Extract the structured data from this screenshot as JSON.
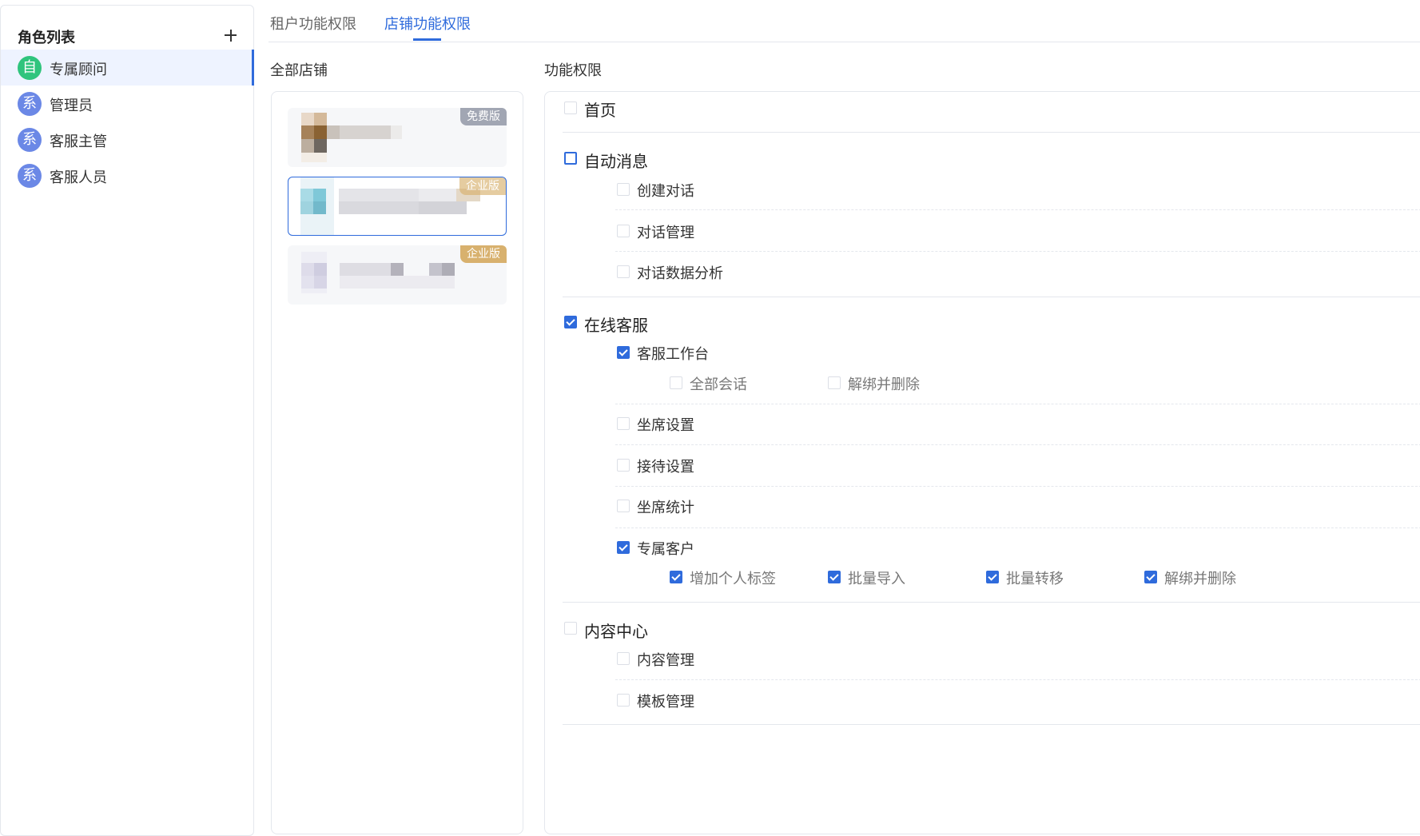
{
  "sidebar": {
    "title": "角色列表",
    "roles": [
      {
        "label": "专属顾问",
        "avatar": "自",
        "avatar_color": "#2fc47d",
        "active": true
      },
      {
        "label": "管理员",
        "avatar": "系",
        "avatar_color": "#6b88e6",
        "active": false
      },
      {
        "label": "客服主管",
        "avatar": "系",
        "avatar_color": "#6b88e6",
        "active": false
      },
      {
        "label": "客服人员",
        "avatar": "系",
        "avatar_color": "#6b88e6",
        "active": false
      }
    ]
  },
  "tabs": [
    {
      "label": "租户功能权限",
      "active": false
    },
    {
      "label": "店铺功能权限",
      "active": true
    }
  ],
  "stores": {
    "title": "全部店铺",
    "cards": [
      {
        "badge": "免费版",
        "badge_type": "free",
        "selected": false
      },
      {
        "badge": "企业版",
        "badge_type": "pro",
        "selected": true
      },
      {
        "badge": "企业版",
        "badge_type": "pro",
        "selected": false
      }
    ]
  },
  "permissions": {
    "title": "功能权限",
    "groups": [
      {
        "label": "首页",
        "checked": false,
        "children": []
      },
      {
        "label": "自动消息",
        "checked": false,
        "children": [
          {
            "label": "创建对话",
            "checked": false,
            "children": []
          },
          {
            "label": "对话管理",
            "checked": false,
            "children": []
          },
          {
            "label": "对话数据分析",
            "checked": false,
            "children": []
          }
        ]
      },
      {
        "label": "在线客服",
        "checked": true,
        "children": [
          {
            "label": "客服工作台",
            "checked": true,
            "children": [
              {
                "label": "全部会话",
                "checked": false
              },
              {
                "label": "解绑并删除",
                "checked": false
              }
            ]
          },
          {
            "label": "坐席设置",
            "checked": false,
            "children": []
          },
          {
            "label": "接待设置",
            "checked": false,
            "children": []
          },
          {
            "label": "坐席统计",
            "checked": false,
            "children": []
          },
          {
            "label": "专属客户",
            "checked": true,
            "children": [
              {
                "label": "增加个人标签",
                "checked": true
              },
              {
                "label": "批量导入",
                "checked": true
              },
              {
                "label": "批量转移",
                "checked": true
              },
              {
                "label": "解绑并删除",
                "checked": true
              }
            ]
          }
        ]
      },
      {
        "label": "内容中心",
        "checked": false,
        "children": [
          {
            "label": "内容管理",
            "checked": false,
            "children": []
          },
          {
            "label": "模板管理",
            "checked": false,
            "children": []
          }
        ]
      }
    ]
  },
  "colors": {
    "accent": "#2f6bdc",
    "badge_free": "#a1a6b3",
    "badge_pro": "#d8b16e"
  }
}
